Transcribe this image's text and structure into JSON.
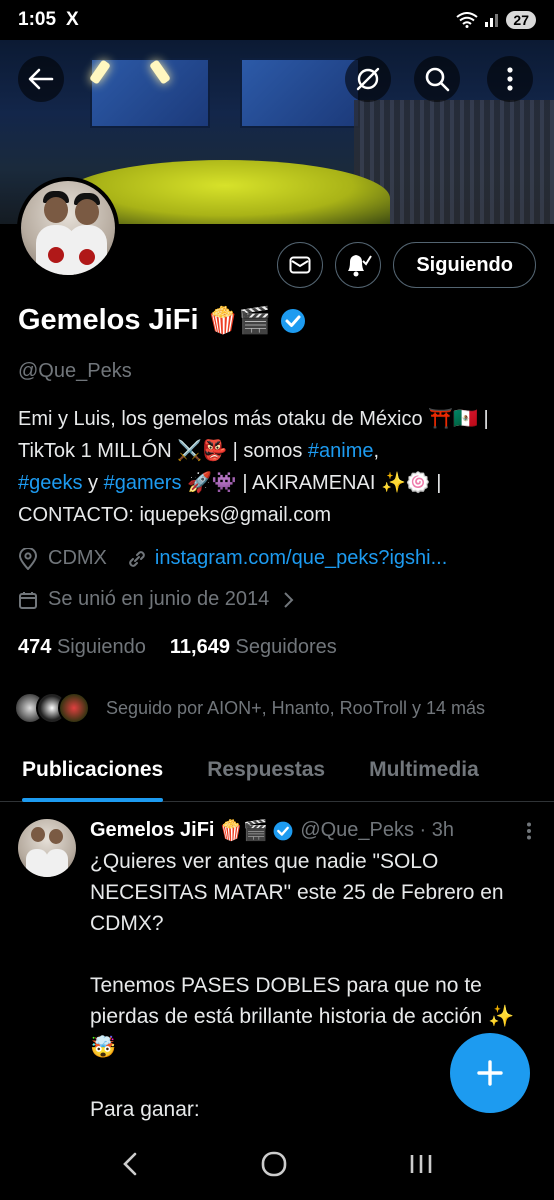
{
  "status_bar": {
    "time": "1:05",
    "app_logo": "X",
    "battery": "27"
  },
  "colors": {
    "accent": "#1d9bf0",
    "background": "#000000",
    "muted": "#71767b",
    "border": "#2f3336"
  },
  "header": {
    "back_icon": "arrow-left-icon",
    "hide_icon": "eye-slash-icon",
    "search_icon": "search-icon",
    "more_icon": "more-vertical-icon"
  },
  "profile": {
    "name": "Gemelos JiFi",
    "name_emoji": "🍿🎬",
    "handle": "@Que_Peks",
    "bio_parts": {
      "p1": "Emi y Luis, los gemelos más otaku de México ",
      "e1": "⛩️🇲🇽",
      "p2": " | TikTok 1 MILLÓN ",
      "e2": "⚔️👺",
      "p3": " | somos ",
      "tag_anime": "#anime",
      "p4": ",",
      "tag_geeks": "#geeks",
      "p5": " y ",
      "tag_gamers": "#gamers",
      "p6": " ",
      "e3": "🚀👾",
      "p7": " | AKIRAMENAI ",
      "e4": "✨🍥",
      "p8": " | CONTACTO: iquepeks@gmail.com"
    },
    "location": "CDMX",
    "link": "instagram.com/que_peks?igshi...",
    "joined": "Se unió en junio de 2014",
    "following_count": "474",
    "following_label": "Siguiendo",
    "followers_count": "11,649",
    "followers_label": "Seguidores",
    "followed_by": "Seguido por AION+, Hnanto, RooTroll y 14 más",
    "follow_button": "Siguiendo"
  },
  "tabs": [
    {
      "label": "Publicaciones",
      "active": true
    },
    {
      "label": "Respuestas",
      "active": false
    },
    {
      "label": "Multimedia",
      "active": false
    }
  ],
  "post": {
    "name": "Gemelos JiFi",
    "name_emoji": "🍿🎬",
    "handle_time": "@Que_Peks · 3h",
    "text": "¿Quieres ver antes que nadie \"SOLO NECESITAS MATAR\" este 25 de Febrero en CDMX?\n\nTenemos PASES DOBLES para que no te pierdas de está brillante historia de acción ✨🤯\n\nPara ganar:"
  },
  "fab_icon": "plus-icon",
  "nav": {
    "back_icon": "nav-back-icon",
    "home_icon": "nav-home-icon",
    "recents_icon": "nav-recents-icon"
  }
}
